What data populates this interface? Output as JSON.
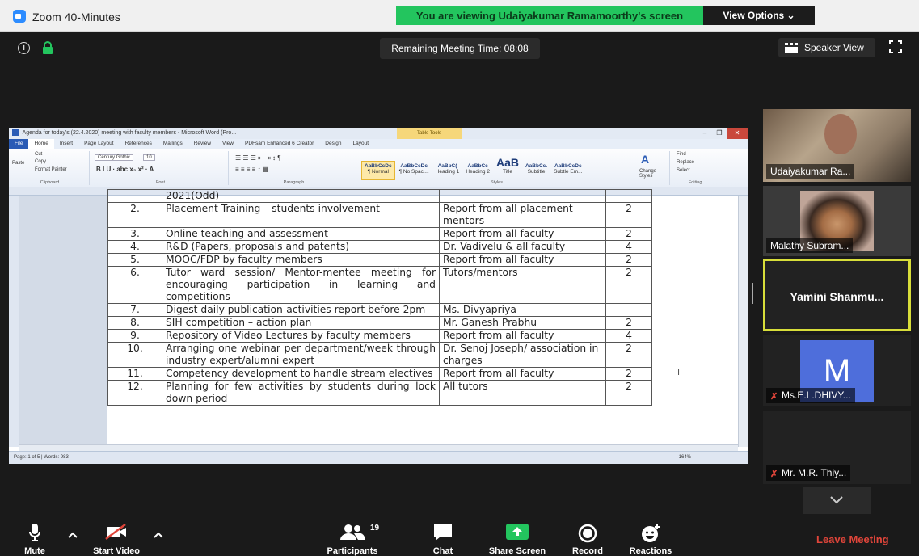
{
  "window": {
    "title": "Zoom 40-Minutes",
    "viewing_banner": "You are viewing Udaiyakumar Ramamoorthy's screen",
    "view_options": "View Options ⌄"
  },
  "meeting": {
    "remaining_time": "Remaining Meeting Time: 08:08",
    "speaker_view": "Speaker View"
  },
  "word": {
    "title": "Agenda for today's (22.4.2020) meeting with faculty members - Microsoft Word (Pro...",
    "context_tab": "Table Tools",
    "tabs": [
      "File",
      "Home",
      "Insert",
      "Page Layout",
      "References",
      "Mailings",
      "Review",
      "View",
      "PDFsam Enhanced 6 Creator",
      "Design",
      "Layout"
    ],
    "clipboard": {
      "cut": "Cut",
      "copy": "Copy",
      "paste": "Paste",
      "format_painter": "Format Painter",
      "label": "Clipboard"
    },
    "font": {
      "name": "Century Gothic",
      "size": "10",
      "label": "Font"
    },
    "paragraph_label": "Paragraph",
    "styles": [
      {
        "preview": "AaBbCcDc",
        "name": "¶ Normal"
      },
      {
        "preview": "AaBbCcDc",
        "name": "¶ No Spaci..."
      },
      {
        "preview": "AaBbC(",
        "name": "Heading 1"
      },
      {
        "preview": "AaBbCc",
        "name": "Heading 2"
      },
      {
        "preview": "AaB",
        "name": "Title"
      },
      {
        "preview": "AaBbCc.",
        "name": "Subtitle"
      },
      {
        "preview": "AaBbCcDc",
        "name": "Subtle Em..."
      }
    ],
    "styles_label": "Styles",
    "change_styles": "Change Styles",
    "editing": {
      "find": "Find",
      "replace": "Replace",
      "select": "Select",
      "label": "Editing"
    },
    "status": "Page: 1 of 5 | Words: 983",
    "zoom": "164%"
  },
  "agenda_rows": [
    {
      "num": "",
      "topic": "2021(Odd)",
      "resp": "",
      "count": ""
    },
    {
      "num": "2.",
      "topic": "Placement Training – students involvement",
      "resp": "Report from all placement mentors",
      "count": "2"
    },
    {
      "num": "3.",
      "topic": "Online teaching and assessment",
      "resp": "Report from all faculty",
      "count": "2"
    },
    {
      "num": "4.",
      "topic": "R&D (Papers, proposals and patents)",
      "resp": "Dr. Vadivelu & all faculty",
      "count": "4"
    },
    {
      "num": "5.",
      "topic": "MOOC/FDP by faculty members",
      "resp": "Report from all faculty",
      "count": "2"
    },
    {
      "num": "6.",
      "topic": "Tutor ward session/ Mentor-mentee meeting for encouraging participation in learning and competitions",
      "resp": "Tutors/mentors",
      "count": "2"
    },
    {
      "num": "7.",
      "topic": "Digest daily publication-activities report before 2pm",
      "resp": "Ms. Divyapriya",
      "count": ""
    },
    {
      "num": "8.",
      "topic": "SIH competition – action plan",
      "resp": "Mr. Ganesh Prabhu",
      "count": "2"
    },
    {
      "num": "9.",
      "topic": "Repository of Video Lectures by faculty members",
      "resp": "Report from all faculty",
      "count": "4"
    },
    {
      "num": "10.",
      "topic": "Arranging one webinar per department/week through industry expert/alumni expert",
      "resp": "Dr. Senoj Joseph/ association in charges",
      "count": "2"
    },
    {
      "num": "11.",
      "topic": "Competency development to handle stream electives",
      "resp": "Report from all faculty",
      "count": "2"
    },
    {
      "num": "12.",
      "topic": "Planning for few activities by students during lock down period",
      "resp": "All tutors",
      "count": "2"
    }
  ],
  "participants_panel": [
    {
      "name": "Udaiyakumar Ra...",
      "muted": false
    },
    {
      "name": "Malathy Subram...",
      "muted": false
    },
    {
      "name": "Yamini Shanmu...",
      "muted": false
    },
    {
      "name": "Ms.E.L.DHIVY...",
      "muted": true,
      "avatar": "M"
    },
    {
      "name": "Mr. M.R. Thiy...",
      "muted": true
    }
  ],
  "toolbar": {
    "mute": "Mute",
    "start_video": "Start Video",
    "participants": "Participants",
    "participants_count": "19",
    "chat": "Chat",
    "share_screen": "Share Screen",
    "record": "Record",
    "reactions": "Reactions",
    "leave": "Leave Meeting"
  },
  "colors": {
    "banner_green": "#23c55e",
    "leave_red": "#e0453a",
    "active_speaker_border": "#d8de3a",
    "avatar_blue": "#4e6edb"
  }
}
